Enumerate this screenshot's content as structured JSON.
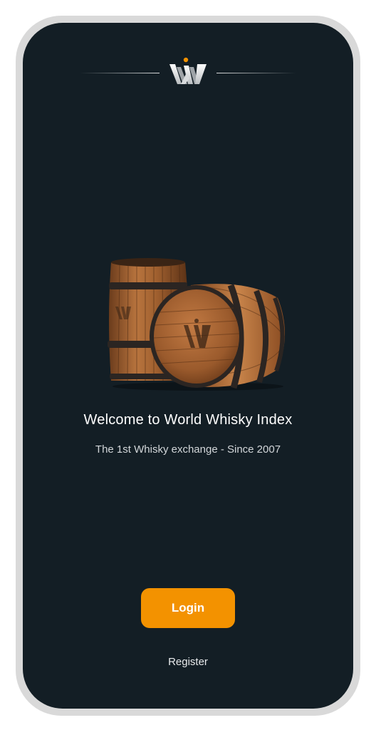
{
  "app": {
    "logo_icon": "world-whisky-index-logo",
    "hero_image": "whisky-barrels"
  },
  "welcome": {
    "title": "Welcome to World Whisky Index",
    "tagline": "The 1st Whisky exchange - Since 2007"
  },
  "actions": {
    "login_label": "Login",
    "register_label": "Register"
  },
  "colors": {
    "background": "#131e25",
    "accent": "#f39200",
    "frame": "#d9d9d9"
  }
}
